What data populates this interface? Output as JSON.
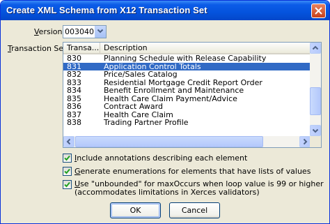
{
  "window": {
    "title": "Create XML Schema from X12 Transaction Set"
  },
  "version": {
    "label_prefix": "V",
    "label_rest": "ersion:",
    "value": "003040"
  },
  "transaction_set": {
    "label_prefix": "T",
    "label_rest": "ransaction Set:",
    "columns": [
      "Transa...",
      "Description"
    ],
    "rows": [
      {
        "code": "830",
        "description": "Planning Schedule with Release Capability",
        "selected": false
      },
      {
        "code": "831",
        "description": "Application Control Totals",
        "selected": true
      },
      {
        "code": "832",
        "description": "Price/Sales Catalog",
        "selected": false
      },
      {
        "code": "833",
        "description": "Residential Mortgage Credit Report Order",
        "selected": false
      },
      {
        "code": "834",
        "description": "Benefit Enrollment and Maintenance",
        "selected": false
      },
      {
        "code": "835",
        "description": "Health Care Claim Payment/Advice",
        "selected": false
      },
      {
        "code": "836",
        "description": "Contract Award",
        "selected": false
      },
      {
        "code": "837",
        "description": "Health Care Claim",
        "selected": false
      },
      {
        "code": "838",
        "description": "Trading Partner Profile",
        "selected": false
      }
    ]
  },
  "options": {
    "annotations": {
      "prefix": "I",
      "rest": "nclude annotations describing each element",
      "checked": true
    },
    "enumerations": {
      "prefix": "G",
      "rest": "enerate enumerations for elements that have lists of values",
      "checked": true
    },
    "unbounded": {
      "prefix": "U",
      "rest": "se \"unbounded\" for maxOccurs when loop value is 99 or higher",
      "line2": "(accommodates limitations in Xerces validators)",
      "checked": true
    }
  },
  "buttons": {
    "ok": "OK",
    "cancel": "Cancel"
  },
  "colors": {
    "titlebar": "#0453dd",
    "selection": "#316ac5",
    "dialog_bg": "#ece9d8"
  }
}
